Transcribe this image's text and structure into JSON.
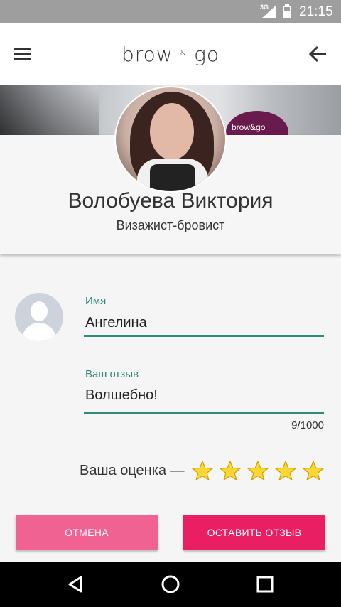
{
  "status_bar": {
    "network": "3G",
    "time": "21:15"
  },
  "app_bar": {
    "logo_main": "brow",
    "logo_amp": "&",
    "logo_end": "go"
  },
  "cover": {
    "shop_text": "brow&go"
  },
  "master": {
    "name": "Волобуева Виктория",
    "role": "Визажист-бровист"
  },
  "form": {
    "name_label": "Имя",
    "name_value": "Ангелина",
    "review_label": "Ваш отзыв",
    "review_value": "Волшебно!",
    "counter": "9/1000"
  },
  "rating": {
    "label": "Ваша оценка —",
    "value": 5,
    "max": 5
  },
  "buttons": {
    "cancel": "ОТМЕНА",
    "submit": "ОСТАВИТЬ ОТЗЫВ"
  },
  "colors": {
    "accent_teal": "#2f8a78",
    "pink_light": "#f06292",
    "pink": "#e91e63",
    "star": "#fdd835"
  }
}
